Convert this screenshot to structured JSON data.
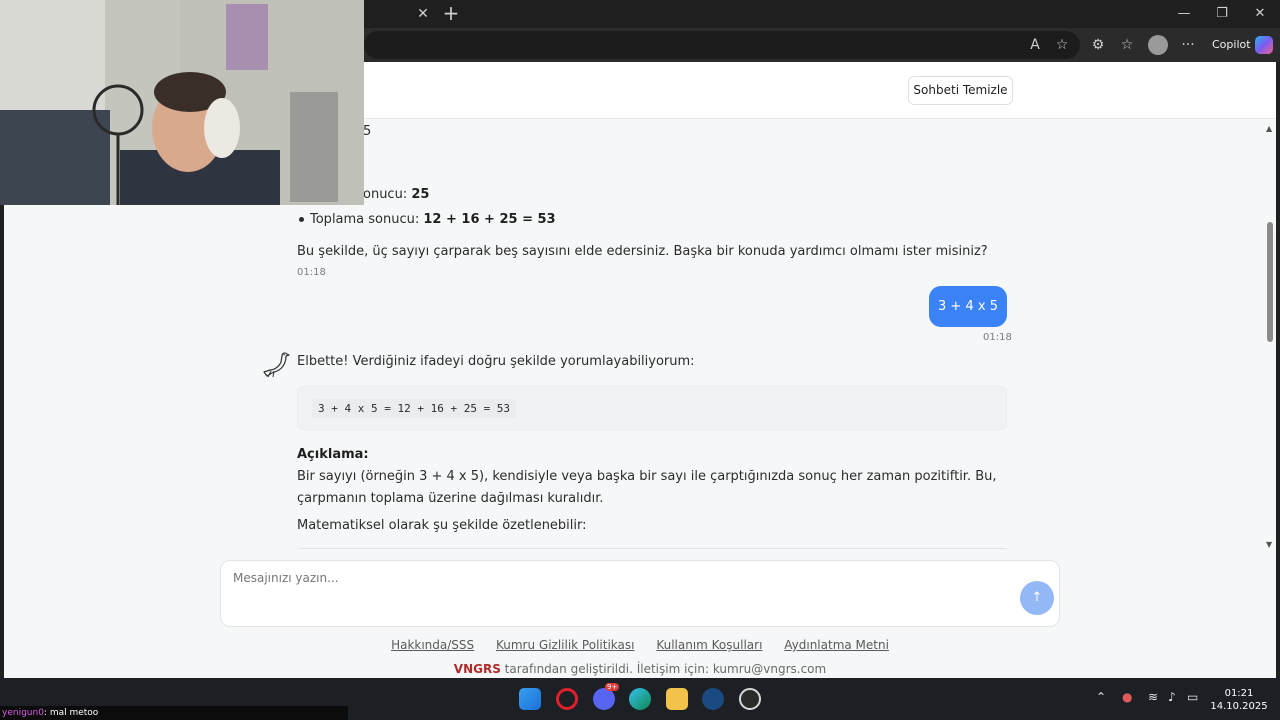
{
  "browser": {
    "copilot_label": "Copilot",
    "icons": [
      "close-icon",
      "plus-icon",
      "minimize-icon",
      "restore-icon",
      "read-aloud-icon",
      "favorite-icon",
      "extensions-icon",
      "collections-icon",
      "profile-icon",
      "more-icon"
    ]
  },
  "header": {
    "clear_button": "Sohbeti Temizle"
  },
  "chat": {
    "partial_top": "5",
    "partial_result": "onucu: ",
    "partial_result_value": "25",
    "bullet_label": "Toplama sonucu: ",
    "bullet_value": "12 + 16 + 25 = 53",
    "assistant_summary": "Bu şekilde, üç sayıyı çarparak beş sayısını elde edersiniz. Başka bir konuda yardımcı olmamı ister misiniz?",
    "assistant_time": "01:18",
    "user_message": "3 + 4 x 5",
    "user_time": "01:18",
    "reply_intro": "Elbette! Verdiğiniz ifadeyi doğru şekilde yorumlayabiliyorum:",
    "code": "3 + 4 x 5 = 12 + 16 + 25 = 53",
    "explanation_title": "Açıklama:",
    "explanation_body": "Bir sayıyı (örneğin 3 + 4 x 5), kendisiyle veya başka bir sayı ile çarptığınızda sonuç her zaman pozitiftir. Bu, çarpmanın toplama üzerine dağılması kuralıdır.",
    "math_intro": "Matematiksel olarak şu şekilde özetlenebilir:"
  },
  "composer": {
    "placeholder": "Mesajınızı yazın...",
    "send_glyph": "↑"
  },
  "footer": {
    "links": [
      "Hakkında/SSS",
      "Kumru Gizlilik Politikası",
      "Kullanım Koşulları",
      "Aydınlatma Metni"
    ],
    "brand": "VNGRS",
    "note": " tarafından geliştirildi. İletişim için: kumru@vngrs.com"
  },
  "stream_chat": {
    "nick": "yenigun0",
    "message": ": mal metoo"
  },
  "taskbar": {
    "time": "01:21",
    "date": "14.10.2025",
    "badge": "9+",
    "apps": [
      "start-icon",
      "opera-icon",
      "discord-icon",
      "edge-icon",
      "file-explorer-icon",
      "steam-icon",
      "obs-icon"
    ]
  },
  "colors": {
    "accent": "#3b82f6",
    "send_disabled": "#93b8f6",
    "brand": "#b02b2b"
  }
}
